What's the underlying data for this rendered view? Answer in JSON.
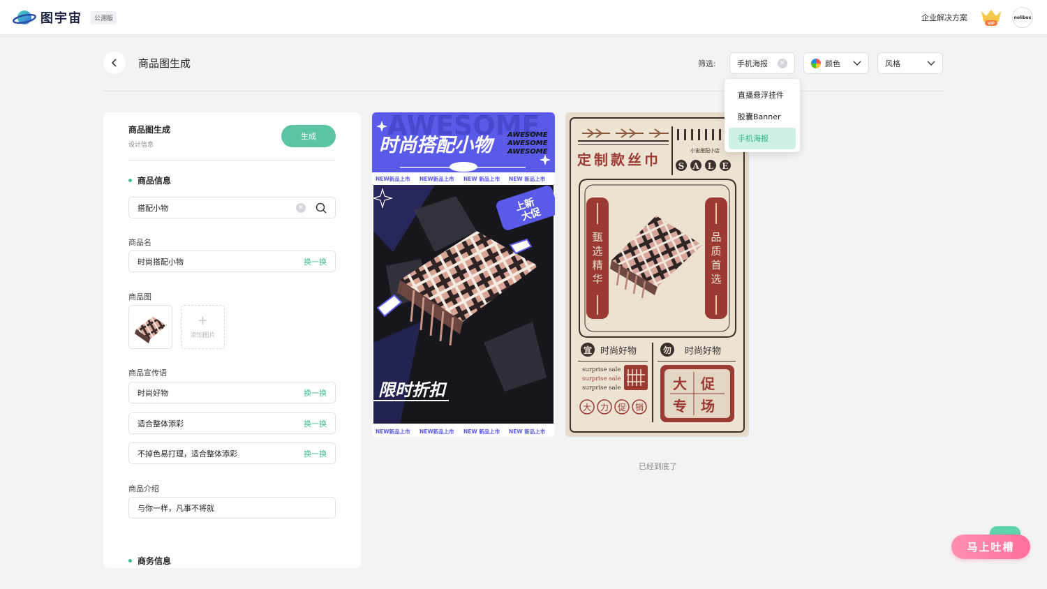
{
  "header": {
    "logo_text": "图宇宙",
    "beta_badge": "公测版",
    "enterprise_link": "企业解决方案",
    "vip_label": "VIP",
    "avatar_text": "nolibox"
  },
  "page": {
    "title": "商品图生成",
    "filter_label": "筛选:",
    "filters": {
      "type_selected": "手机海报",
      "color_label": "颜色",
      "style_label": "风格"
    },
    "dropdown_options": [
      "直播悬浮挂件",
      "胶囊Banner",
      "手机海报"
    ],
    "dropdown_active": "手机海报",
    "end_text": "已经到底了",
    "feedback_label": "马上吐槽"
  },
  "panel": {
    "title": "商品图生成",
    "subtitle": "设计信息",
    "generate_label": "生成",
    "section_product": "商品信息",
    "search_value": "搭配小物",
    "name_label": "商品名",
    "name_value": "时尚搭配小物",
    "swap_label": "换一换",
    "image_label": "商品图",
    "add_image_label": "添加图片",
    "slogan_label": "商品宣传语",
    "slogans": [
      "时尚好物",
      "适合整体添彩",
      "不掉色易打理，适合整体添彩"
    ],
    "intro_label": "商品介绍",
    "intro_value": "与你一样，凡事不将就",
    "section_business": "商务信息"
  },
  "poster1": {
    "headline": "时尚搭配小物",
    "awesome": [
      "AWESOME",
      "AWESOME",
      "AWESOME"
    ],
    "bg_word": "AWESOME",
    "ticker": [
      "NEW新品上市",
      "NEW新品上市",
      "NEW 新品上市",
      "NEW 新品上市"
    ],
    "tag_line1": "上新",
    "tag_line2": "大促",
    "discount": "限时折扣",
    "colors": {
      "primary": "#5a5ae8",
      "dark": "#15151a"
    }
  },
  "poster2": {
    "title": "定制款丝巾",
    "shop": "小宙搭配小店",
    "sale": [
      "S",
      "A",
      "L",
      "E"
    ],
    "left_banner": [
      "甄",
      "选",
      "精",
      "华"
    ],
    "right_banner": [
      "品",
      "质",
      "首",
      "选"
    ],
    "tag1_icon": "宜",
    "tag1_text": "时尚好物",
    "tag2_icon": "勿",
    "tag2_text": "时尚好物",
    "surprise": [
      "surprise sale",
      "surprise sale",
      "surprise sale"
    ],
    "promo_chars": [
      "大",
      "力",
      "促",
      "销"
    ],
    "stamp": [
      "大",
      "促",
      "专",
      "场"
    ],
    "colors": {
      "red": "#9a3a32",
      "cream": "#ece3d2"
    }
  },
  "colors": {
    "accent": "#5bc4a4",
    "accent_text": "#3fb98f"
  }
}
